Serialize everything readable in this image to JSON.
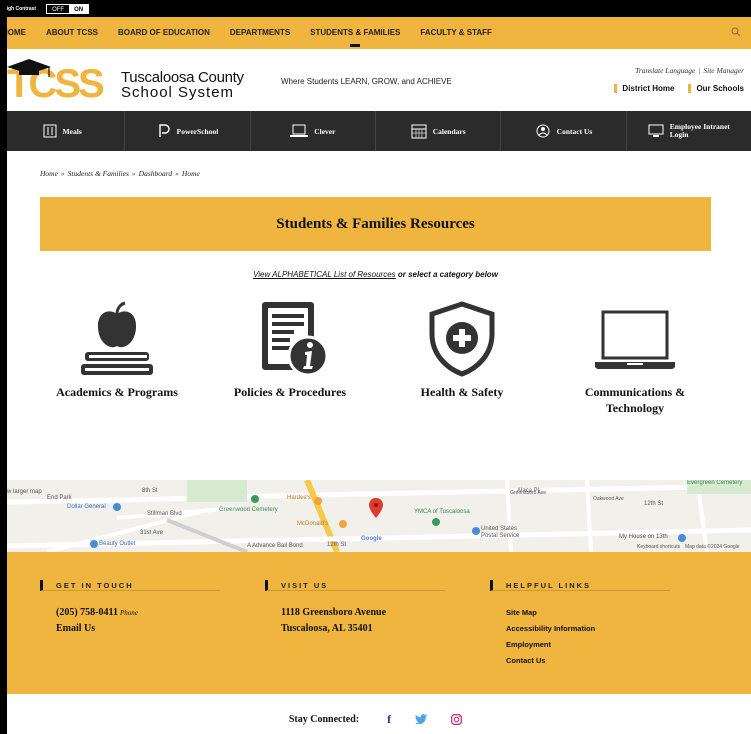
{
  "high_contrast": {
    "label": "High Contrast",
    "off": "OFF",
    "on": "ON"
  },
  "nav": {
    "items": [
      {
        "label": "HOME"
      },
      {
        "label": "ABOUT TCSS"
      },
      {
        "label": "BOARD OF EDUCATION"
      },
      {
        "label": "DEPARTMENTS"
      },
      {
        "label": "STUDENTS & FAMILIES"
      },
      {
        "label": "FACULTY & STAFF"
      }
    ],
    "search_icon": "search-icon"
  },
  "header": {
    "logo_letters": "TCSS",
    "org_name_line1": "Tuscaloosa County",
    "org_name_line2": "School System",
    "tagline": "Where Students LEARN, GROW, and ACHIEVE",
    "translate": "Translate Language",
    "site_manager": "Site Manager",
    "separator": "|",
    "district_home": "District Home",
    "our_schools": "Our Schools"
  },
  "quick_links": [
    {
      "label": "Meals",
      "icon": "meals-icon"
    },
    {
      "label": "PowerSchool",
      "icon": "powerschool-icon"
    },
    {
      "label": "Clever",
      "icon": "laptop-icon"
    },
    {
      "label": "Calendars",
      "icon": "calendar-icon"
    },
    {
      "label": "Contact Us",
      "icon": "contact-icon"
    },
    {
      "label": "Employee Intranet",
      "label2": "Login",
      "icon": "monitor-icon"
    }
  ],
  "breadcrumb": [
    "Home",
    "Students & Families",
    "Dashboard",
    "Home"
  ],
  "breadcrumb_sep": "»",
  "page_title": "Students & Families Resources",
  "alpha_link": "View ALPHABETICAL List of Resources",
  "alpha_suffix": " or select a category below",
  "categories": [
    {
      "label": "Academics & Programs",
      "icon": "apple-books-icon"
    },
    {
      "label": "Policies & Procedures",
      "icon": "document-info-icon"
    },
    {
      "label": "Health & Safety",
      "icon": "shield-plus-icon"
    },
    {
      "label": "Communications &",
      "label2": "Technology",
      "icon": "laptop-icon"
    }
  ],
  "map": {
    "labels": [
      "w larger map",
      "End Park",
      "Dollar General",
      "Stillman Blvd",
      "Beauty Outlet",
      "Greenwood Cemetery",
      "Hardee's",
      "McDonald's",
      "A Advance Bail Bond",
      "12th St",
      "Google",
      "YMCA of Tuscaloosa",
      "United States Postal Service",
      "Alaca Pl",
      "12th St",
      "My House on 13th",
      "Evergreen Cemetery",
      "Keyboard shortcuts",
      "Map data ©2024 Google",
      "8th St",
      "31st Ave",
      "Greensboro Ave",
      "Oakwood Ave"
    ]
  },
  "footer": {
    "get_in_touch": {
      "heading": "GET IN TOUCH",
      "phone": "(205) 758-0411",
      "phone_note": "Phone",
      "email": "Email Us"
    },
    "visit_us": {
      "heading": "VISIT US",
      "line1": "1118 Greensboro Avenue",
      "line2": "Tuscaloosa, AL 35401"
    },
    "helpful_links": {
      "heading": "HELPFUL LINKS",
      "links": [
        "Site Map",
        "Accessibility Information",
        "Employment",
        "Contact Us"
      ]
    }
  },
  "stay_connected": "Stay Connected:",
  "social": [
    {
      "label": "f",
      "icon": "facebook-icon",
      "color": "#1d3f8f"
    },
    {
      "label": "twitter",
      "icon": "twitter-icon",
      "color": "#4aa6e8"
    },
    {
      "label": "instagram",
      "icon": "instagram-icon",
      "color": "#c13584"
    }
  ],
  "colors": {
    "gold": "#f0b53f",
    "dark_bar": "#2b2b2b",
    "black": "#000000"
  }
}
